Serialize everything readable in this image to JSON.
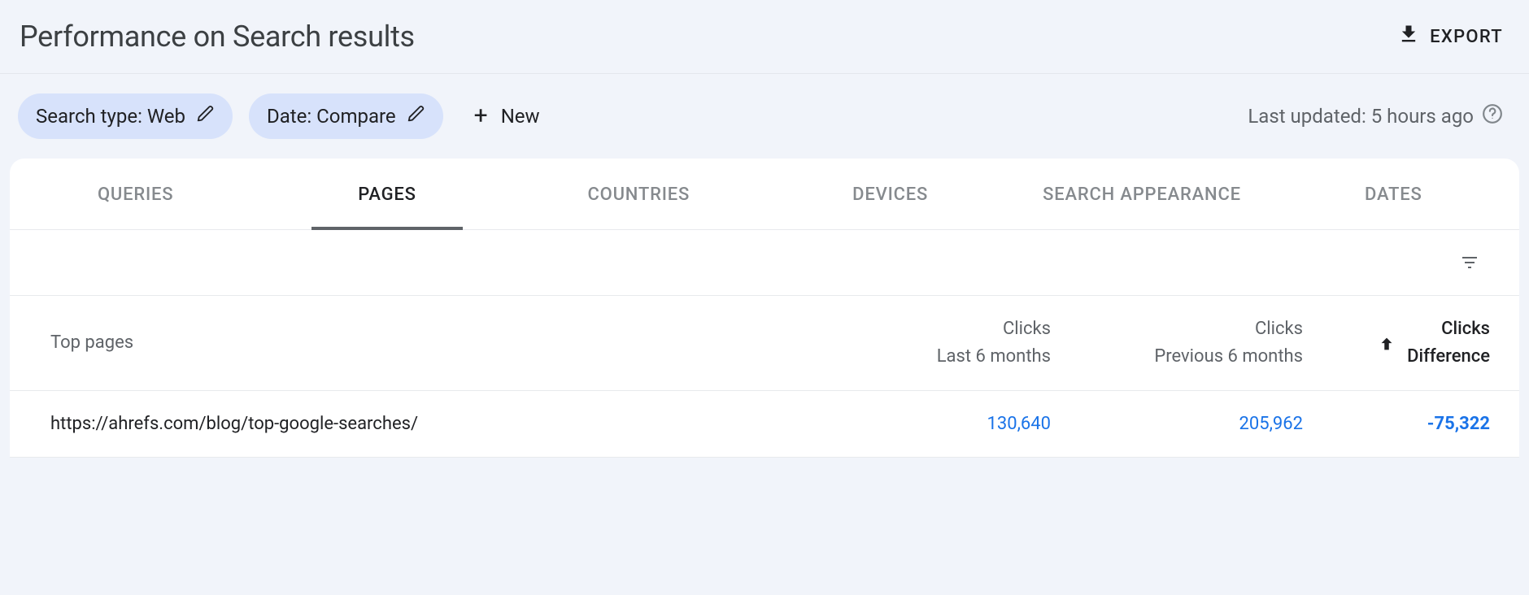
{
  "header": {
    "title": "Performance on Search results",
    "export_label": "EXPORT"
  },
  "filters": {
    "search_type_chip": "Search type: Web",
    "date_chip": "Date: Compare",
    "new_label": "New",
    "last_updated": "Last updated: 5 hours ago"
  },
  "tabs": [
    "QUERIES",
    "PAGES",
    "COUNTRIES",
    "DEVICES",
    "SEARCH APPEARANCE",
    "DATES"
  ],
  "active_tab": "PAGES",
  "table": {
    "columns": {
      "pages": "Top pages",
      "clicks_last": {
        "line1": "Clicks",
        "line2": "Last 6 months"
      },
      "clicks_prev": {
        "line1": "Clicks",
        "line2": "Previous 6 months"
      },
      "clicks_diff": {
        "line1": "Clicks",
        "line2": "Difference"
      }
    },
    "rows": [
      {
        "page": "https://ahrefs.com/blog/top-google-searches/",
        "clicks_last": "130,640",
        "clicks_prev": "205,962",
        "clicks_diff": "-75,322"
      }
    ]
  }
}
